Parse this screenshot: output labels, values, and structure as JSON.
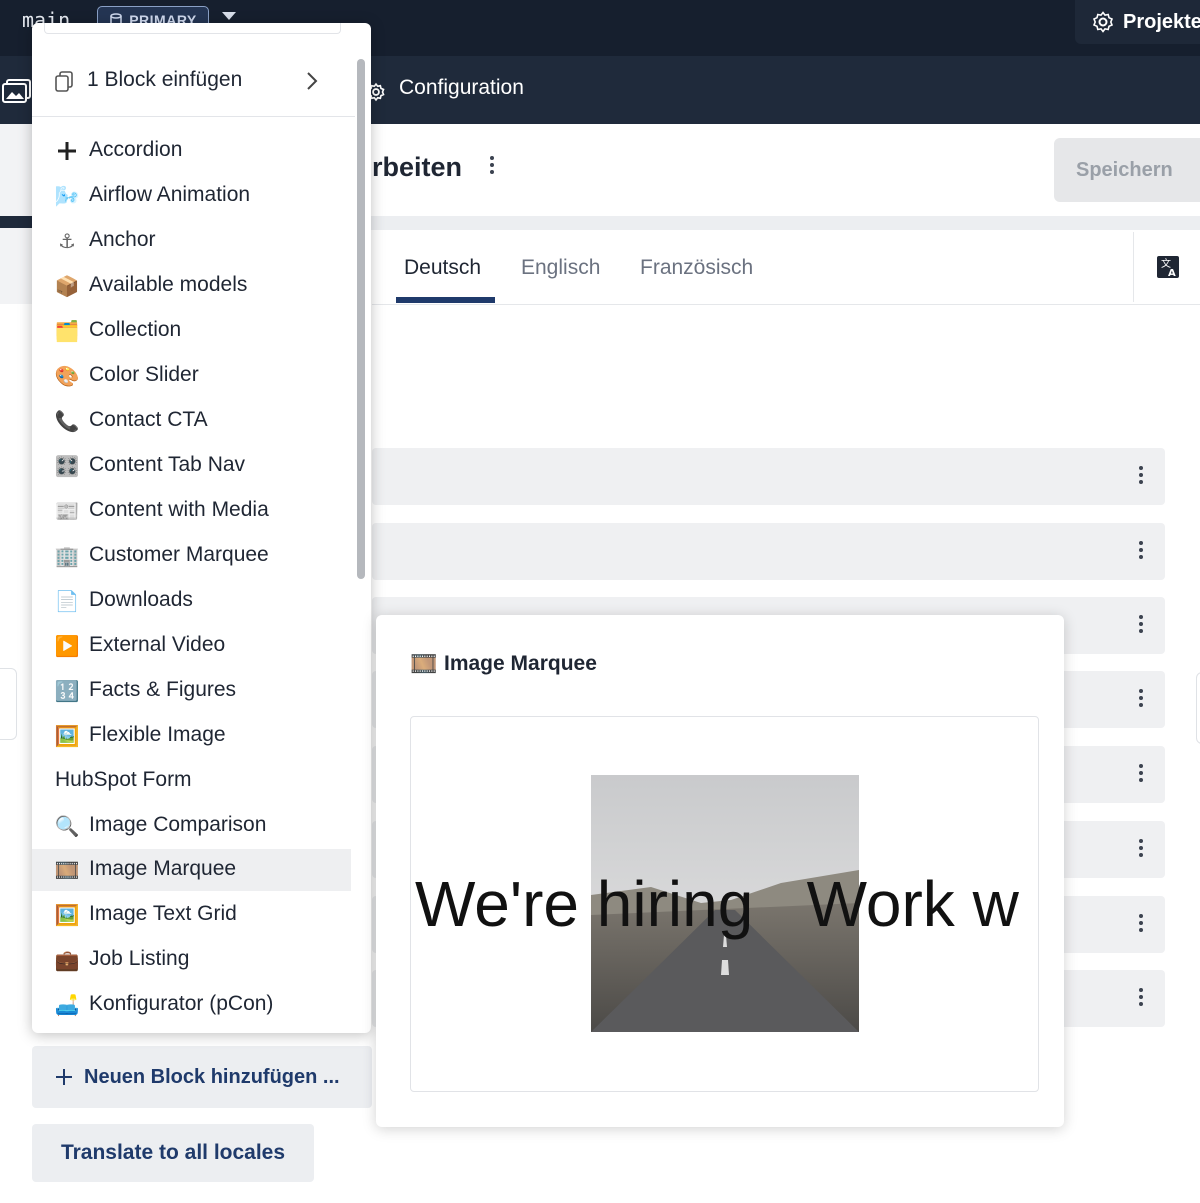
{
  "topbar": {
    "branch": "main",
    "badge": "PRIMARY",
    "project_label": "Projekte"
  },
  "navbar": {
    "configuration": "Configuration"
  },
  "page": {
    "title_partial": "rbeiten",
    "save_label": "Speichern"
  },
  "tabs": [
    {
      "label": "Deutsch",
      "active": true
    },
    {
      "label": "Englisch",
      "active": false
    },
    {
      "label": "Französisch",
      "active": false
    }
  ],
  "actions": {
    "add_block": "Neuen Block hinzufügen ...",
    "translate_all": "Translate to all locales"
  },
  "menu": {
    "insert_label": "1 Block einfügen",
    "items": [
      {
        "label": "Accordion",
        "icon": "plus-icon"
      },
      {
        "label": "Airflow Animation",
        "icon": "wind-icon"
      },
      {
        "label": "Anchor",
        "icon": "anchor-icon"
      },
      {
        "label": "Available models",
        "icon": "package-icon"
      },
      {
        "label": "Collection",
        "icon": "card-box-icon"
      },
      {
        "label": "Color Slider",
        "icon": "palette-icon"
      },
      {
        "label": "Contact CTA",
        "icon": "phone-icon"
      },
      {
        "label": "Content Tab Nav",
        "icon": "control-knobs-icon"
      },
      {
        "label": "Content with Media",
        "icon": "newspaper-icon"
      },
      {
        "label": "Customer Marquee",
        "icon": "office-building-icon"
      },
      {
        "label": "Downloads",
        "icon": "page-icon"
      },
      {
        "label": "External Video",
        "icon": "play-icon"
      },
      {
        "label": "Facts & Figures",
        "icon": "numbers-icon"
      },
      {
        "label": "Flexible Image",
        "icon": "framed-picture-icon"
      },
      {
        "label": "HubSpot Form",
        "icon": ""
      },
      {
        "label": "Image Comparison",
        "icon": "magnifier-icon"
      },
      {
        "label": "Image Marquee",
        "icon": "film-icon",
        "selected": true
      },
      {
        "label": "Image Text Grid",
        "icon": "framed-picture-icon"
      },
      {
        "label": "Job Listing",
        "icon": "briefcase-icon"
      },
      {
        "label": "Konfigurator (pCon)",
        "icon": "sofa-icon"
      }
    ]
  },
  "preview": {
    "title": "Image Marquee",
    "marquee_text": "We're hiring   Work w"
  },
  "colors": {
    "topbar": "#161f2e",
    "navbar": "#1f2a3b",
    "accent": "#1f3a6b"
  }
}
